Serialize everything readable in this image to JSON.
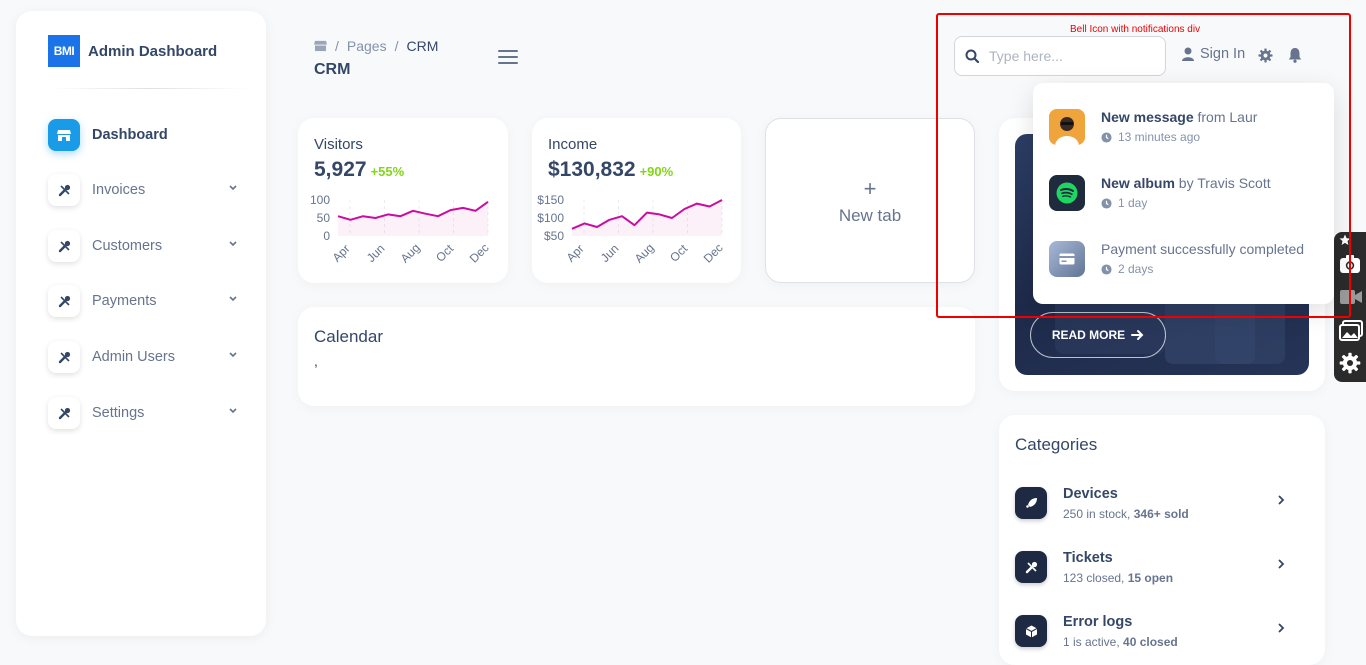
{
  "sidebar": {
    "brand_logo": "BMI",
    "brand_name": "Admin Dashboard",
    "items": [
      {
        "label": "Dashboard",
        "icon": "store-icon"
      },
      {
        "label": "Invoices",
        "icon": "tools-icon"
      },
      {
        "label": "Customers",
        "icon": "tools-icon"
      },
      {
        "label": "Payments",
        "icon": "tools-icon"
      },
      {
        "label": "Admin Users",
        "icon": "tools-icon"
      },
      {
        "label": "Settings",
        "icon": "tools-icon"
      }
    ]
  },
  "header": {
    "breadcrumb": [
      "Pages",
      "CRM"
    ],
    "title": "CRM",
    "search_placeholder": "Type here...",
    "signin_label": "Sign In"
  },
  "annotation": {
    "label": "Bell Icon with notifications div",
    "color": "#ee0000"
  },
  "stats": [
    {
      "title": "Visitors",
      "value": "5,927",
      "change": "+55%",
      "chart_data": {
        "type": "line",
        "categories": [
          "Apr",
          "Jun",
          "Aug",
          "Oct",
          "Dec"
        ],
        "y_ticks": [
          "100",
          "50",
          "0"
        ],
        "ylim": [
          0,
          100
        ]
      }
    },
    {
      "title": "Income",
      "value": "$130,832",
      "change": "+90%",
      "chart_data": {
        "type": "line",
        "categories": [
          "Apr",
          "Jun",
          "Aug",
          "Oct",
          "Dec"
        ],
        "y_ticks": [
          "$150",
          "$100",
          "$50"
        ],
        "ylim": [
          50,
          150
        ]
      }
    }
  ],
  "new_tab": {
    "plus": "+",
    "label": "New tab"
  },
  "calendar": {
    "title": "Calendar",
    "body": ","
  },
  "hero": {
    "button_label": "READ MORE"
  },
  "notifications": [
    {
      "strong": "New message",
      "rest": " from Laur",
      "time": "13 minutes ago",
      "avatar": "person-avatar"
    },
    {
      "strong": "New album",
      "rest": " by Travis Scott",
      "time": "1 day",
      "avatar": "spotify-icon"
    },
    {
      "strong": "",
      "rest": "Payment successfully completed",
      "time": "2 days",
      "avatar": "credit-card-icon"
    }
  ],
  "categories": {
    "title": "Categories",
    "items": [
      {
        "name": "Devices",
        "sub_a": "250 in stock, ",
        "sub_b": "346+ sold",
        "icon": "rocket-icon"
      },
      {
        "name": "Tickets",
        "sub_a": "123 closed, ",
        "sub_b": "15 open",
        "icon": "tools-icon"
      },
      {
        "name": "Error logs",
        "sub_a": "1 is active, ",
        "sub_b": "40 closed",
        "icon": "box-icon"
      }
    ]
  },
  "colors": {
    "accent": "#1a9be8",
    "positive": "#82d616",
    "chart_line": "#cb0c9f",
    "text": "#344767"
  }
}
